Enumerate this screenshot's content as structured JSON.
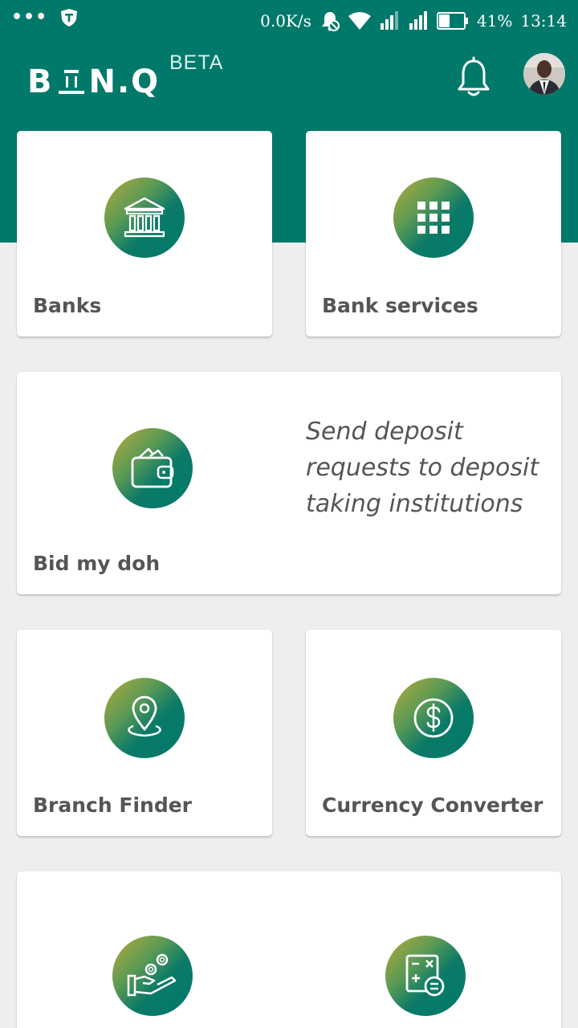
{
  "status_bar": {
    "net_speed": "0.0K/s",
    "battery": "41%",
    "time": "13:14"
  },
  "app_bar": {
    "logo_left": "B",
    "logo_right": "N.Q",
    "badge": "BETA"
  },
  "cards": {
    "banks": {
      "label": "Banks",
      "icon": "bank-building-icon"
    },
    "bank_services": {
      "label": "Bank services",
      "icon": "grid-icon"
    },
    "bid_my_doh": {
      "label": "Bid my doh",
      "icon": "wallet-icon",
      "tagline": "Send deposit requests to deposit taking institutions"
    },
    "branch_finder": {
      "label": "Branch Finder",
      "icon": "location-pin-icon"
    },
    "currency_converter": {
      "label": "Currency Converter",
      "icon": "dollar-coin-icon"
    },
    "savings": {
      "icon": "hand-coins-icon"
    },
    "calculator": {
      "icon": "calculator-icon"
    }
  },
  "colors": {
    "brand": "#00796b",
    "background": "#eeeeee",
    "card_text": "#555555"
  }
}
